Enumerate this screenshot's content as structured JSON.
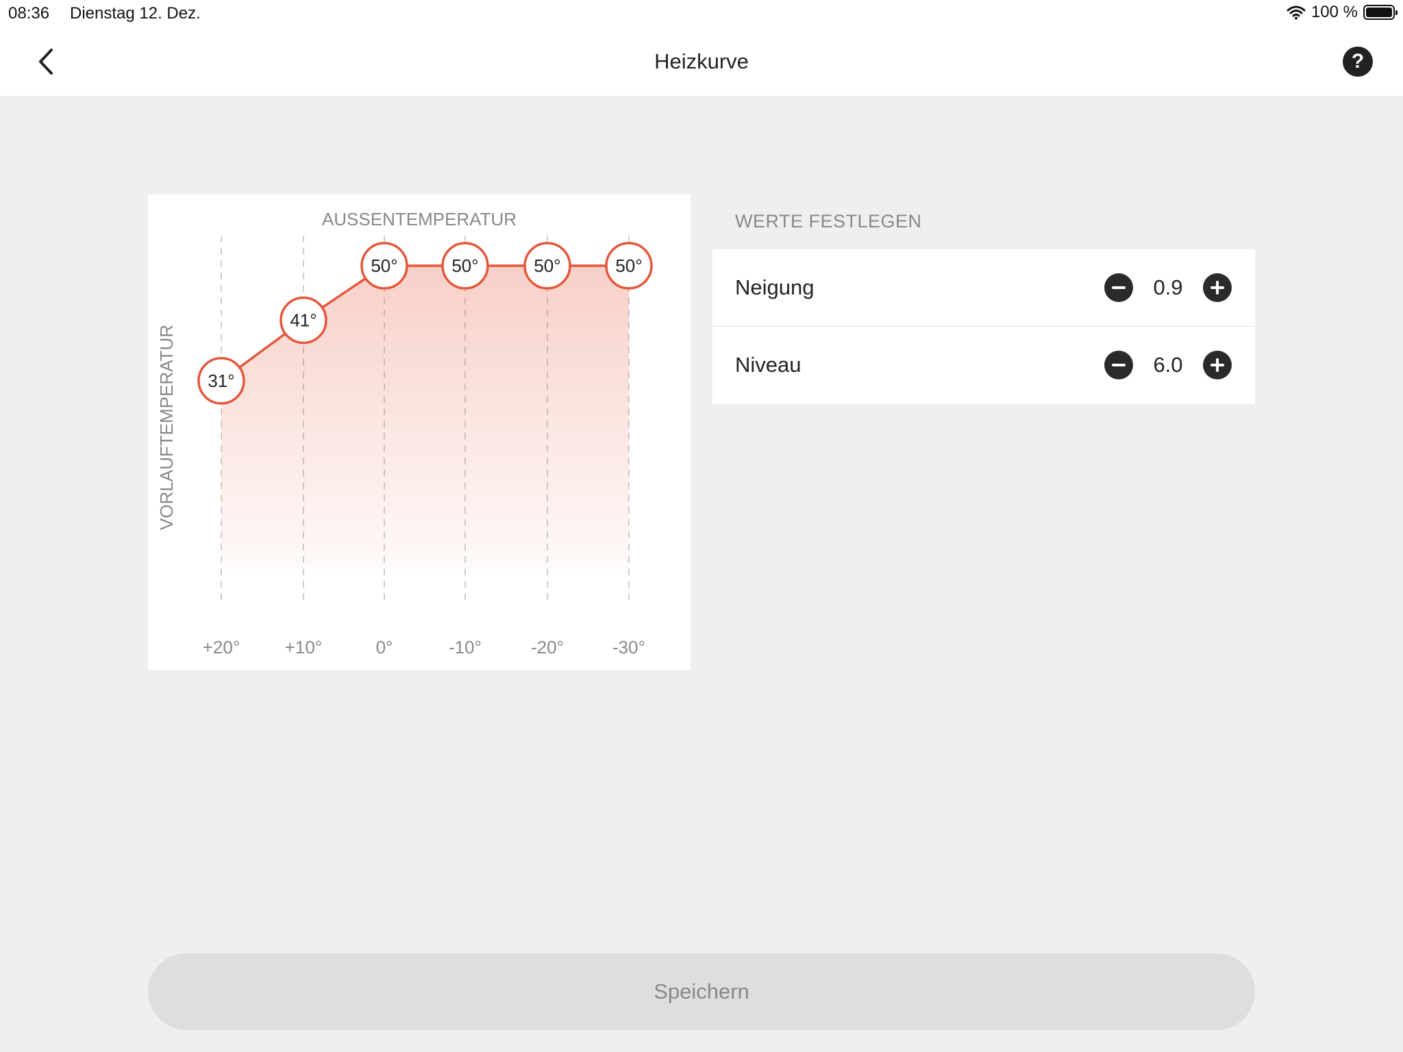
{
  "status_bar": {
    "time": "08:36",
    "date": "Dienstag 12. Dez.",
    "battery": "100 %"
  },
  "nav": {
    "title": "Heizkurve",
    "back_icon": "chevron-left-icon",
    "help_icon": "question-circle-icon",
    "help_symbol": "?"
  },
  "chart": {
    "top_label": "AUSSENTEMPERATUR",
    "side_label": "VORLAUFTEMPERATUR"
  },
  "chart_data": {
    "type": "area",
    "xlabel": "AUSSENTEMPERATUR",
    "ylabel": "VORLAUFTEMPERATUR",
    "x": [
      "+20°",
      "+10°",
      "0°",
      "-10°",
      "-20°",
      "-30°"
    ],
    "values": [
      31,
      41,
      50,
      50,
      50,
      50
    ],
    "point_labels": [
      "31°",
      "41°",
      "50°",
      "50°",
      "50°",
      "50°"
    ],
    "color": "#e4573b"
  },
  "settings": {
    "header": "WERTE FESTLEGEN",
    "rows": [
      {
        "label": "Neigung",
        "value": "0.9"
      },
      {
        "label": "Niveau",
        "value": "6.0"
      }
    ]
  },
  "save": {
    "label": "Speichern"
  },
  "colors": {
    "accent": "#e4573b",
    "background": "#efefef",
    "card": "#ffffff"
  }
}
